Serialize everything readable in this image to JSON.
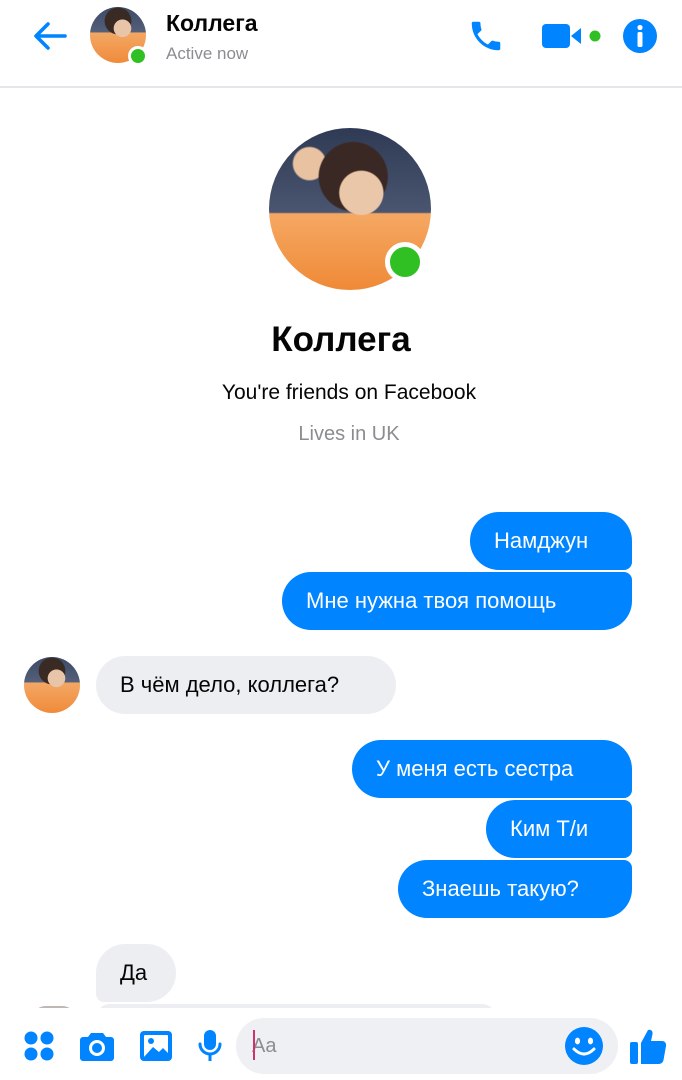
{
  "colors": {
    "accent": "#0084ff",
    "online": "#31c024",
    "incoming_bubble": "#eceef1",
    "secondary_text": "#8a8d91"
  },
  "header": {
    "title": "Коллега",
    "status": "Active now",
    "icons": [
      "back-arrow-icon",
      "phone-icon",
      "video-camera-icon",
      "info-icon"
    ]
  },
  "profile": {
    "name": "Коллега",
    "friends_text": "You're friends on Facebook",
    "location": "Lives in UK"
  },
  "messages": [
    {
      "direction": "outgoing",
      "text": "Намджун"
    },
    {
      "direction": "outgoing",
      "text": "Мне нужна твоя помощь"
    },
    {
      "direction": "incoming",
      "text": "В чём дело, коллега?"
    },
    {
      "direction": "outgoing",
      "text": "У меня есть сестра"
    },
    {
      "direction": "outgoing",
      "text": "Ким Т/и"
    },
    {
      "direction": "outgoing",
      "text": "Знаешь такую?"
    },
    {
      "direction": "incoming",
      "text": "Да"
    }
  ],
  "composer": {
    "placeholder": "Aa",
    "value": "",
    "icons": [
      "apps-grid-icon",
      "camera-icon",
      "gallery-icon",
      "microphone-icon",
      "emoji-icon",
      "thumbs-up-icon"
    ]
  }
}
